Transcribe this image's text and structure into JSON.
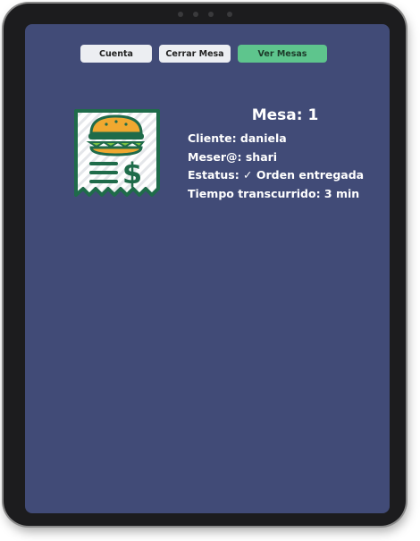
{
  "toolbar": {
    "cuenta_label": "Cuenta",
    "cerrar_mesa_label": "Cerrar Mesa",
    "ver_mesas_label": "Ver Mesas"
  },
  "mesa": {
    "title": "Mesa: 1",
    "cliente": "Cliente: daniela",
    "mesero": "Meser@: shari",
    "estatus": "Estatus: ✓ Orden entregada",
    "tiempo": "Tiempo transcurrido: 3 min"
  },
  "icons": {
    "receipt": "burger-receipt-icon"
  },
  "colors": {
    "screen_bg": "#414b77",
    "button_bg": "#eceef2",
    "accent_button": "#5ec58d",
    "icon_green": "#1f6b4a",
    "icon_bun": "#f0a830"
  }
}
